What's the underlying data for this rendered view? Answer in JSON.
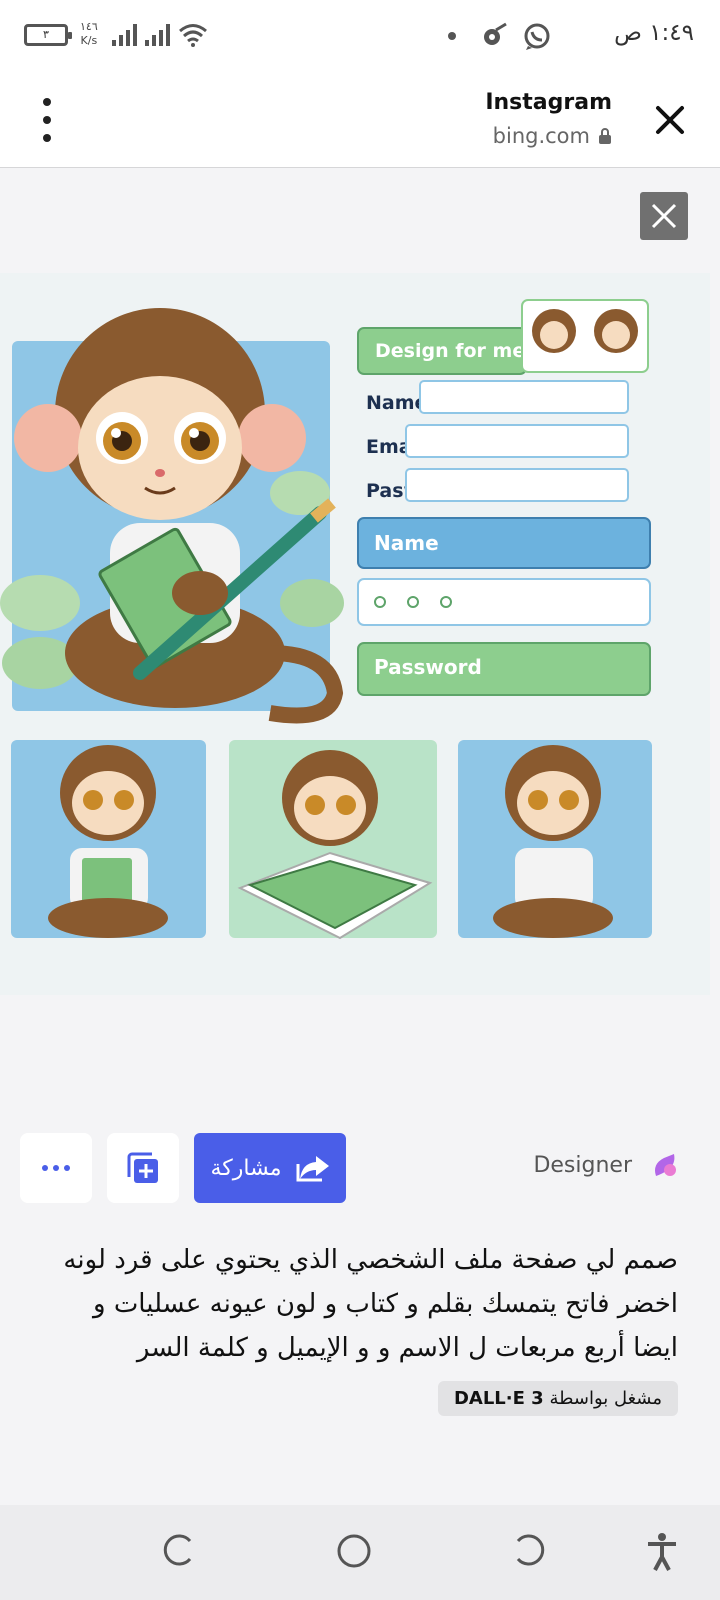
{
  "status_bar": {
    "time": "١:٤٩ ص",
    "battery": "٣",
    "net_speed_value": "١٤٦",
    "net_speed_unit": "K/s"
  },
  "browser": {
    "title": "Instagram",
    "url": "bing.com"
  },
  "image_mockup": {
    "header_button": "Design for me",
    "labels": [
      "Name",
      "Email",
      "Pasword"
    ],
    "name_button": "Name",
    "password_button": "Password"
  },
  "actions": {
    "share_label": "مشاركة",
    "designer_label": "Designer"
  },
  "prompt_text": "صمم لي صفحة ملف الشخصي الذي يحتوي على قرد لونه اخضر فاتح يتمسك بقلم و كتاب و لون عيونه عسليات و ايضا أربع مربعات ل الاسم و و الإيميل و كلمة السر",
  "badge": {
    "prefix": "مشغل بواسطة",
    "model": "DALL·E 3"
  },
  "colors": {
    "accent": "#4a5ee8",
    "green": "#8dce8e",
    "blue": "#6cb2de"
  }
}
